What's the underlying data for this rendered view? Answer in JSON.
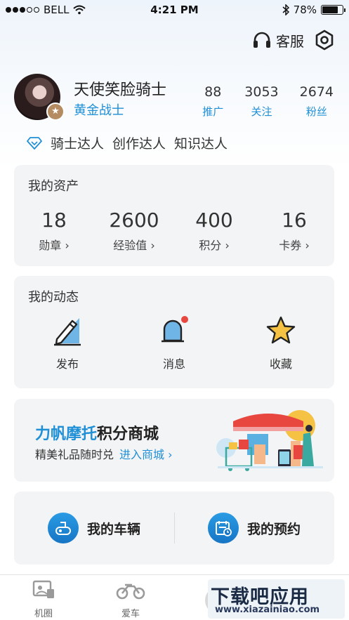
{
  "status_bar": {
    "carrier": "BELL",
    "time": "4:21 PM",
    "battery": "78%",
    "battery_level": 0.78
  },
  "header": {
    "service_label": "客服"
  },
  "profile": {
    "name": "天使笑脸骑士",
    "rank": "黄金战士",
    "stats": [
      {
        "value": "88",
        "label": "推广"
      },
      {
        "value": "3053",
        "label": "关注"
      },
      {
        "value": "2674",
        "label": "粉丝"
      }
    ],
    "tags": [
      "骑士达人",
      "创作达人",
      "知识达人"
    ]
  },
  "assets": {
    "title": "我的资产",
    "items": [
      {
        "value": "18",
        "label": "勋章 ›"
      },
      {
        "value": "2600",
        "label": "经验值 ›"
      },
      {
        "value": "400",
        "label": "积分 ›"
      },
      {
        "value": "16",
        "label": "卡券 ›"
      }
    ]
  },
  "dynamics": {
    "title": "我的动态",
    "items": [
      {
        "label": "发布",
        "icon": "pencil-icon"
      },
      {
        "label": "消息",
        "icon": "bell-icon"
      },
      {
        "label": "收藏",
        "icon": "star-icon"
      }
    ]
  },
  "mall": {
    "brand": "力帆摩托",
    "title_rest": "积分商城",
    "subtitle": "精美礼品随时兑",
    "link": "进入商城 ›"
  },
  "vehicle": {
    "my_vehicle": "我的车辆",
    "my_booking": "我的预约"
  },
  "tabbar": {
    "tabs": [
      {
        "label": "机圈",
        "icon": "moments-icon"
      },
      {
        "label": "爱车",
        "icon": "motorcycle-icon"
      }
    ]
  },
  "watermark": {
    "title": "下载吧应用",
    "url": "www.xiazainiao.com"
  },
  "colors": {
    "accent": "#1f8fd6",
    "card_bg": "#f3f4f6",
    "badge_red": "#e8473f"
  }
}
